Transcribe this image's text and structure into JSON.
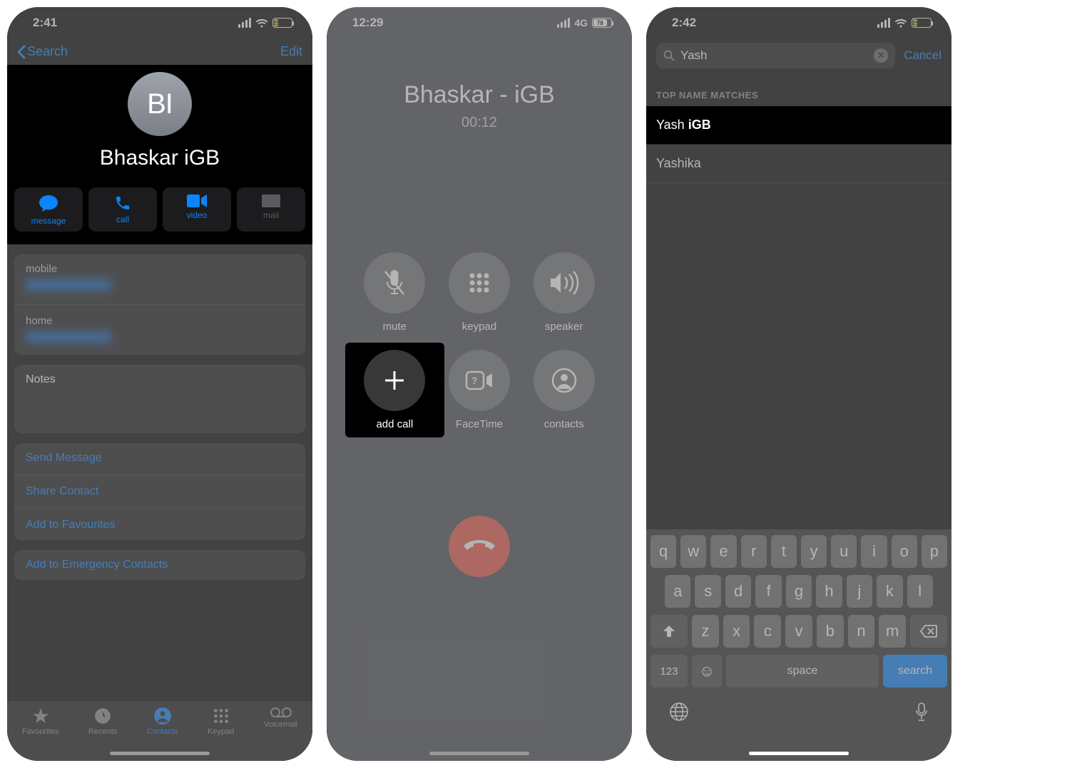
{
  "phone1": {
    "time": "2:41",
    "battery": "25",
    "back_label": "Search",
    "edit_label": "Edit",
    "avatar_initials": "BI",
    "contact_name": "Bhaskar iGB",
    "actions": {
      "message": "message",
      "call": "call",
      "video": "video",
      "mail": "mail"
    },
    "field_mobile": "mobile",
    "field_home": "home",
    "notes_label": "Notes",
    "links": {
      "send": "Send Message",
      "share": "Share Contact",
      "fav": "Add to Favourites",
      "emergency": "Add to Emergency Contacts"
    },
    "tabs": {
      "fav": "Favourites",
      "recents": "Recents",
      "contacts": "Contacts",
      "keypad": "Keypad",
      "voicemail": "Voicemail"
    }
  },
  "phone2": {
    "time": "12:29",
    "carrier": "4G",
    "battery": "78",
    "call_name": "Bhaskar - iGB",
    "call_duration": "00:12",
    "buttons": {
      "mute": "mute",
      "keypad": "keypad",
      "speaker": "speaker",
      "add": "add call",
      "facetime": "FaceTime",
      "contacts": "contacts"
    }
  },
  "phone3": {
    "time": "2:42",
    "battery": "25",
    "search_value": "Yash",
    "cancel_label": "Cancel",
    "section_header": "TOP NAME MATCHES",
    "results": [
      {
        "first": "Yash",
        "last": "iGB"
      },
      {
        "first": "Yashika",
        "last": ""
      }
    ],
    "keys_row1": [
      "q",
      "w",
      "e",
      "r",
      "t",
      "y",
      "u",
      "i",
      "o",
      "p"
    ],
    "keys_row2": [
      "a",
      "s",
      "d",
      "f",
      "g",
      "h",
      "j",
      "k",
      "l"
    ],
    "keys_row3": [
      "z",
      "x",
      "c",
      "v",
      "b",
      "n",
      "m"
    ],
    "key_123": "123",
    "key_space": "space",
    "key_search": "search"
  }
}
